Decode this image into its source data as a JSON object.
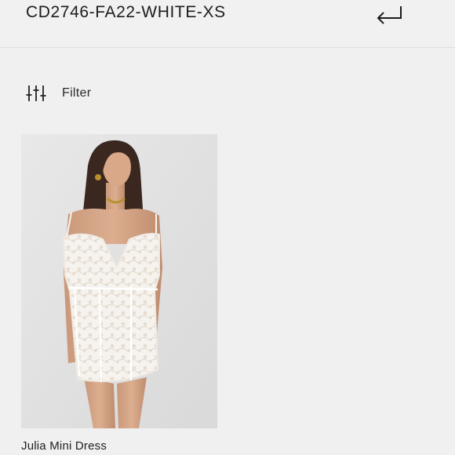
{
  "search": {
    "query": "CD2746-FA22-WHITE-XS",
    "submit_icon": "enter-return-icon"
  },
  "filter": {
    "label": "Filter",
    "icon": "sliders-icon"
  },
  "results": [
    {
      "title": "Julia Mini Dress",
      "image_desc_icon": "product-photo"
    }
  ],
  "colors": {
    "background": "#f0f0f0",
    "text": "#1a1a1a",
    "dress": "#f7f4ef"
  }
}
